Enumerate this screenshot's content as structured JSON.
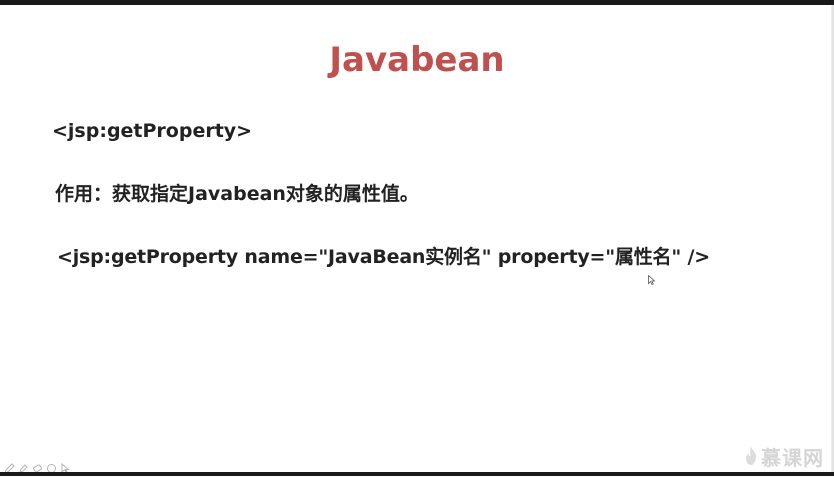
{
  "slide": {
    "title": "Javabean",
    "tag": "<jsp:getProperty>",
    "purpose": "作用：获取指定Javabean对象的属性值。",
    "syntax": "<jsp:getProperty name=\"JavaBean实例名\" property=\"属性名\" />"
  },
  "brand": {
    "text": "慕课网"
  },
  "colors": {
    "title": "#c0504d",
    "body_text": "#222222",
    "frame": "#1a1a1a"
  }
}
